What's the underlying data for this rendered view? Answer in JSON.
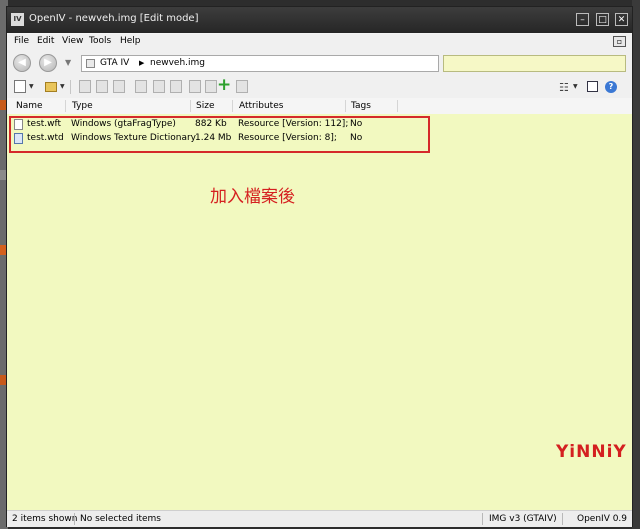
{
  "window": {
    "title": "OpenIV - newveh.img [Edit mode]",
    "app_icon_text": "IV"
  },
  "menu": {
    "items": [
      "File",
      "Edit",
      "View",
      "Tools",
      "Help"
    ]
  },
  "address": {
    "path": [
      "GTA IV",
      "newveh.img"
    ],
    "search_placeholder": ""
  },
  "columns": [
    "Name",
    "Type",
    "Size",
    "Attributes",
    "Tags"
  ],
  "files": [
    {
      "name": "test.wft",
      "type": "Windows (gtaFragType)",
      "size": "882 Kb",
      "attributes": "Resource [Version: 112];",
      "tags": "No"
    },
    {
      "name": "test.wtd",
      "type": "Windows Texture Dictionary",
      "size": "1.24 Mb",
      "attributes": "Resource [Version: 8];",
      "tags": "No"
    }
  ],
  "annotation": "加入檔案後",
  "watermark": "YiNNiY",
  "status": {
    "shown": "2 items shown",
    "selected": "No selected items",
    "format": "IMG v3 (GTAIV)",
    "version": "OpenIV 0.9"
  },
  "colors": {
    "list_background": "#f2f9c0",
    "highlight": "#d52a2a",
    "titlebar": "#2f2f2f",
    "accent_green": "#2ea12e"
  },
  "icons": {
    "nav_back": "back-arrow-icon",
    "nav_forward": "forward-arrow-icon",
    "new_file": "new-file-icon",
    "open_folder": "open-folder-icon",
    "add": "plus-icon",
    "view_mode": "view-list-icon",
    "panel": "panel-icon",
    "help": "help-icon"
  }
}
